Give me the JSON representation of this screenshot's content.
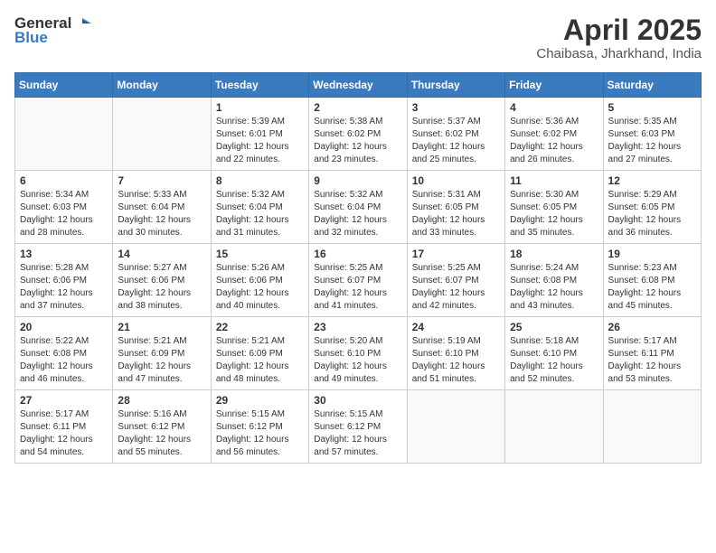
{
  "header": {
    "logo_line1": "General",
    "logo_line2": "Blue",
    "title": "April 2025",
    "subtitle": "Chaibasa, Jharkhand, India"
  },
  "calendar": {
    "days_of_week": [
      "Sunday",
      "Monday",
      "Tuesday",
      "Wednesday",
      "Thursday",
      "Friday",
      "Saturday"
    ],
    "weeks": [
      [
        {
          "day": "",
          "info": ""
        },
        {
          "day": "",
          "info": ""
        },
        {
          "day": "1",
          "info": "Sunrise: 5:39 AM\nSunset: 6:01 PM\nDaylight: 12 hours\nand 22 minutes."
        },
        {
          "day": "2",
          "info": "Sunrise: 5:38 AM\nSunset: 6:02 PM\nDaylight: 12 hours\nand 23 minutes."
        },
        {
          "day": "3",
          "info": "Sunrise: 5:37 AM\nSunset: 6:02 PM\nDaylight: 12 hours\nand 25 minutes."
        },
        {
          "day": "4",
          "info": "Sunrise: 5:36 AM\nSunset: 6:02 PM\nDaylight: 12 hours\nand 26 minutes."
        },
        {
          "day": "5",
          "info": "Sunrise: 5:35 AM\nSunset: 6:03 PM\nDaylight: 12 hours\nand 27 minutes."
        }
      ],
      [
        {
          "day": "6",
          "info": "Sunrise: 5:34 AM\nSunset: 6:03 PM\nDaylight: 12 hours\nand 28 minutes."
        },
        {
          "day": "7",
          "info": "Sunrise: 5:33 AM\nSunset: 6:04 PM\nDaylight: 12 hours\nand 30 minutes."
        },
        {
          "day": "8",
          "info": "Sunrise: 5:32 AM\nSunset: 6:04 PM\nDaylight: 12 hours\nand 31 minutes."
        },
        {
          "day": "9",
          "info": "Sunrise: 5:32 AM\nSunset: 6:04 PM\nDaylight: 12 hours\nand 32 minutes."
        },
        {
          "day": "10",
          "info": "Sunrise: 5:31 AM\nSunset: 6:05 PM\nDaylight: 12 hours\nand 33 minutes."
        },
        {
          "day": "11",
          "info": "Sunrise: 5:30 AM\nSunset: 6:05 PM\nDaylight: 12 hours\nand 35 minutes."
        },
        {
          "day": "12",
          "info": "Sunrise: 5:29 AM\nSunset: 6:05 PM\nDaylight: 12 hours\nand 36 minutes."
        }
      ],
      [
        {
          "day": "13",
          "info": "Sunrise: 5:28 AM\nSunset: 6:06 PM\nDaylight: 12 hours\nand 37 minutes."
        },
        {
          "day": "14",
          "info": "Sunrise: 5:27 AM\nSunset: 6:06 PM\nDaylight: 12 hours\nand 38 minutes."
        },
        {
          "day": "15",
          "info": "Sunrise: 5:26 AM\nSunset: 6:06 PM\nDaylight: 12 hours\nand 40 minutes."
        },
        {
          "day": "16",
          "info": "Sunrise: 5:25 AM\nSunset: 6:07 PM\nDaylight: 12 hours\nand 41 minutes."
        },
        {
          "day": "17",
          "info": "Sunrise: 5:25 AM\nSunset: 6:07 PM\nDaylight: 12 hours\nand 42 minutes."
        },
        {
          "day": "18",
          "info": "Sunrise: 5:24 AM\nSunset: 6:08 PM\nDaylight: 12 hours\nand 43 minutes."
        },
        {
          "day": "19",
          "info": "Sunrise: 5:23 AM\nSunset: 6:08 PM\nDaylight: 12 hours\nand 45 minutes."
        }
      ],
      [
        {
          "day": "20",
          "info": "Sunrise: 5:22 AM\nSunset: 6:08 PM\nDaylight: 12 hours\nand 46 minutes."
        },
        {
          "day": "21",
          "info": "Sunrise: 5:21 AM\nSunset: 6:09 PM\nDaylight: 12 hours\nand 47 minutes."
        },
        {
          "day": "22",
          "info": "Sunrise: 5:21 AM\nSunset: 6:09 PM\nDaylight: 12 hours\nand 48 minutes."
        },
        {
          "day": "23",
          "info": "Sunrise: 5:20 AM\nSunset: 6:10 PM\nDaylight: 12 hours\nand 49 minutes."
        },
        {
          "day": "24",
          "info": "Sunrise: 5:19 AM\nSunset: 6:10 PM\nDaylight: 12 hours\nand 51 minutes."
        },
        {
          "day": "25",
          "info": "Sunrise: 5:18 AM\nSunset: 6:10 PM\nDaylight: 12 hours\nand 52 minutes."
        },
        {
          "day": "26",
          "info": "Sunrise: 5:17 AM\nSunset: 6:11 PM\nDaylight: 12 hours\nand 53 minutes."
        }
      ],
      [
        {
          "day": "27",
          "info": "Sunrise: 5:17 AM\nSunset: 6:11 PM\nDaylight: 12 hours\nand 54 minutes."
        },
        {
          "day": "28",
          "info": "Sunrise: 5:16 AM\nSunset: 6:12 PM\nDaylight: 12 hours\nand 55 minutes."
        },
        {
          "day": "29",
          "info": "Sunrise: 5:15 AM\nSunset: 6:12 PM\nDaylight: 12 hours\nand 56 minutes."
        },
        {
          "day": "30",
          "info": "Sunrise: 5:15 AM\nSunset: 6:12 PM\nDaylight: 12 hours\nand 57 minutes."
        },
        {
          "day": "",
          "info": ""
        },
        {
          "day": "",
          "info": ""
        },
        {
          "day": "",
          "info": ""
        }
      ]
    ]
  }
}
